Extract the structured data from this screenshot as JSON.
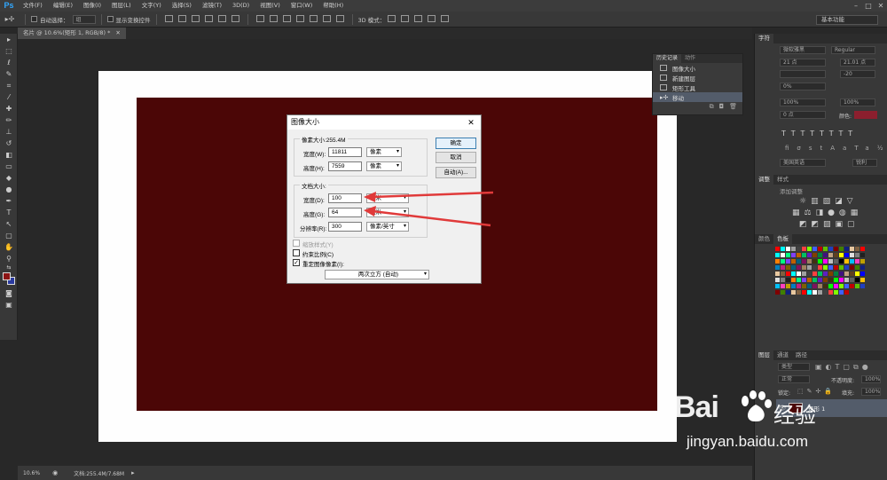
{
  "app": {
    "logo": "Ps"
  },
  "menu": [
    "文件(F)",
    "编辑(E)",
    "图像(I)",
    "图层(L)",
    "文字(Y)",
    "选择(S)",
    "滤镜(T)",
    "3D(D)",
    "视图(V)",
    "窗口(W)",
    "帮助(H)"
  ],
  "options_bar": {
    "auto_select_label": "自动选择：",
    "auto_select_value": "组",
    "show_transform_label": "显示变换控件",
    "mode_3d_label": "3D 模式：",
    "workspace": "基本功能"
  },
  "document": {
    "tab_title": "名片 @ 10.6%(矩形 1, RGB/8) *",
    "zoom": "10.6%",
    "doc_info": "文档:255.4M/7.68M"
  },
  "history_panel": {
    "tabs": [
      "历史记录",
      "动作"
    ],
    "items": [
      "图像大小",
      "新建图层",
      "矩形工具",
      "移动"
    ]
  },
  "char_panel": {
    "tabs": [
      "字符"
    ],
    "font_family": "微软雅黑",
    "font_style": "Regular",
    "size": "21 点",
    "leading": "21.01 点",
    "tracking": "-20",
    "scale_v": "100%",
    "scale_h": "100%",
    "baseline": "0 点",
    "color_label": "颜色:",
    "language": "美国英语",
    "aa": "锐利",
    "percent": "0%"
  },
  "adjust_panel": {
    "tabs": [
      "调整",
      "样式"
    ],
    "title": "添加调整"
  },
  "swatch_panel": {
    "tabs": [
      "颜色",
      "色板"
    ]
  },
  "layers_panel": {
    "tabs": [
      "图层",
      "通道",
      "路径"
    ],
    "filter": "类型",
    "blend": "正常",
    "opacity_label": "不透明度:",
    "opacity": "100%",
    "lock_label": "锁定:",
    "fill_label": "填充:",
    "fill": "100%",
    "layer_name": "矩形 1"
  },
  "dialog": {
    "title": "图像大小",
    "pixel_group": "像素大小:255.4M",
    "width_label": "宽度(W):",
    "width_px": "11811",
    "height_label": "高度(H):",
    "height_px": "7559",
    "unit_px": "像素",
    "doc_group": "文档大小:",
    "doc_width_label": "宽度(D):",
    "doc_width": "100",
    "doc_height_label": "高度(G):",
    "doc_height": "64",
    "unit_mm": "毫米",
    "res_label": "分辨率(R):",
    "res": "300",
    "res_unit": "像素/英寸",
    "ok": "确定",
    "cancel": "取消",
    "auto": "自动(A)...",
    "scale_styles": "缩放样式(Y)",
    "constrain": "约束比例(C)",
    "resample": "重定图像像素(I):",
    "resample_method": "两次立方 (自动)"
  },
  "watermark": {
    "brand": "Bai",
    "brand2": "经验",
    "url": "jingyan.baidu.com"
  },
  "colors": {
    "canvas_red": "#4b0606",
    "arrow": "#e03a3a",
    "fg_color": "#8c1414"
  }
}
